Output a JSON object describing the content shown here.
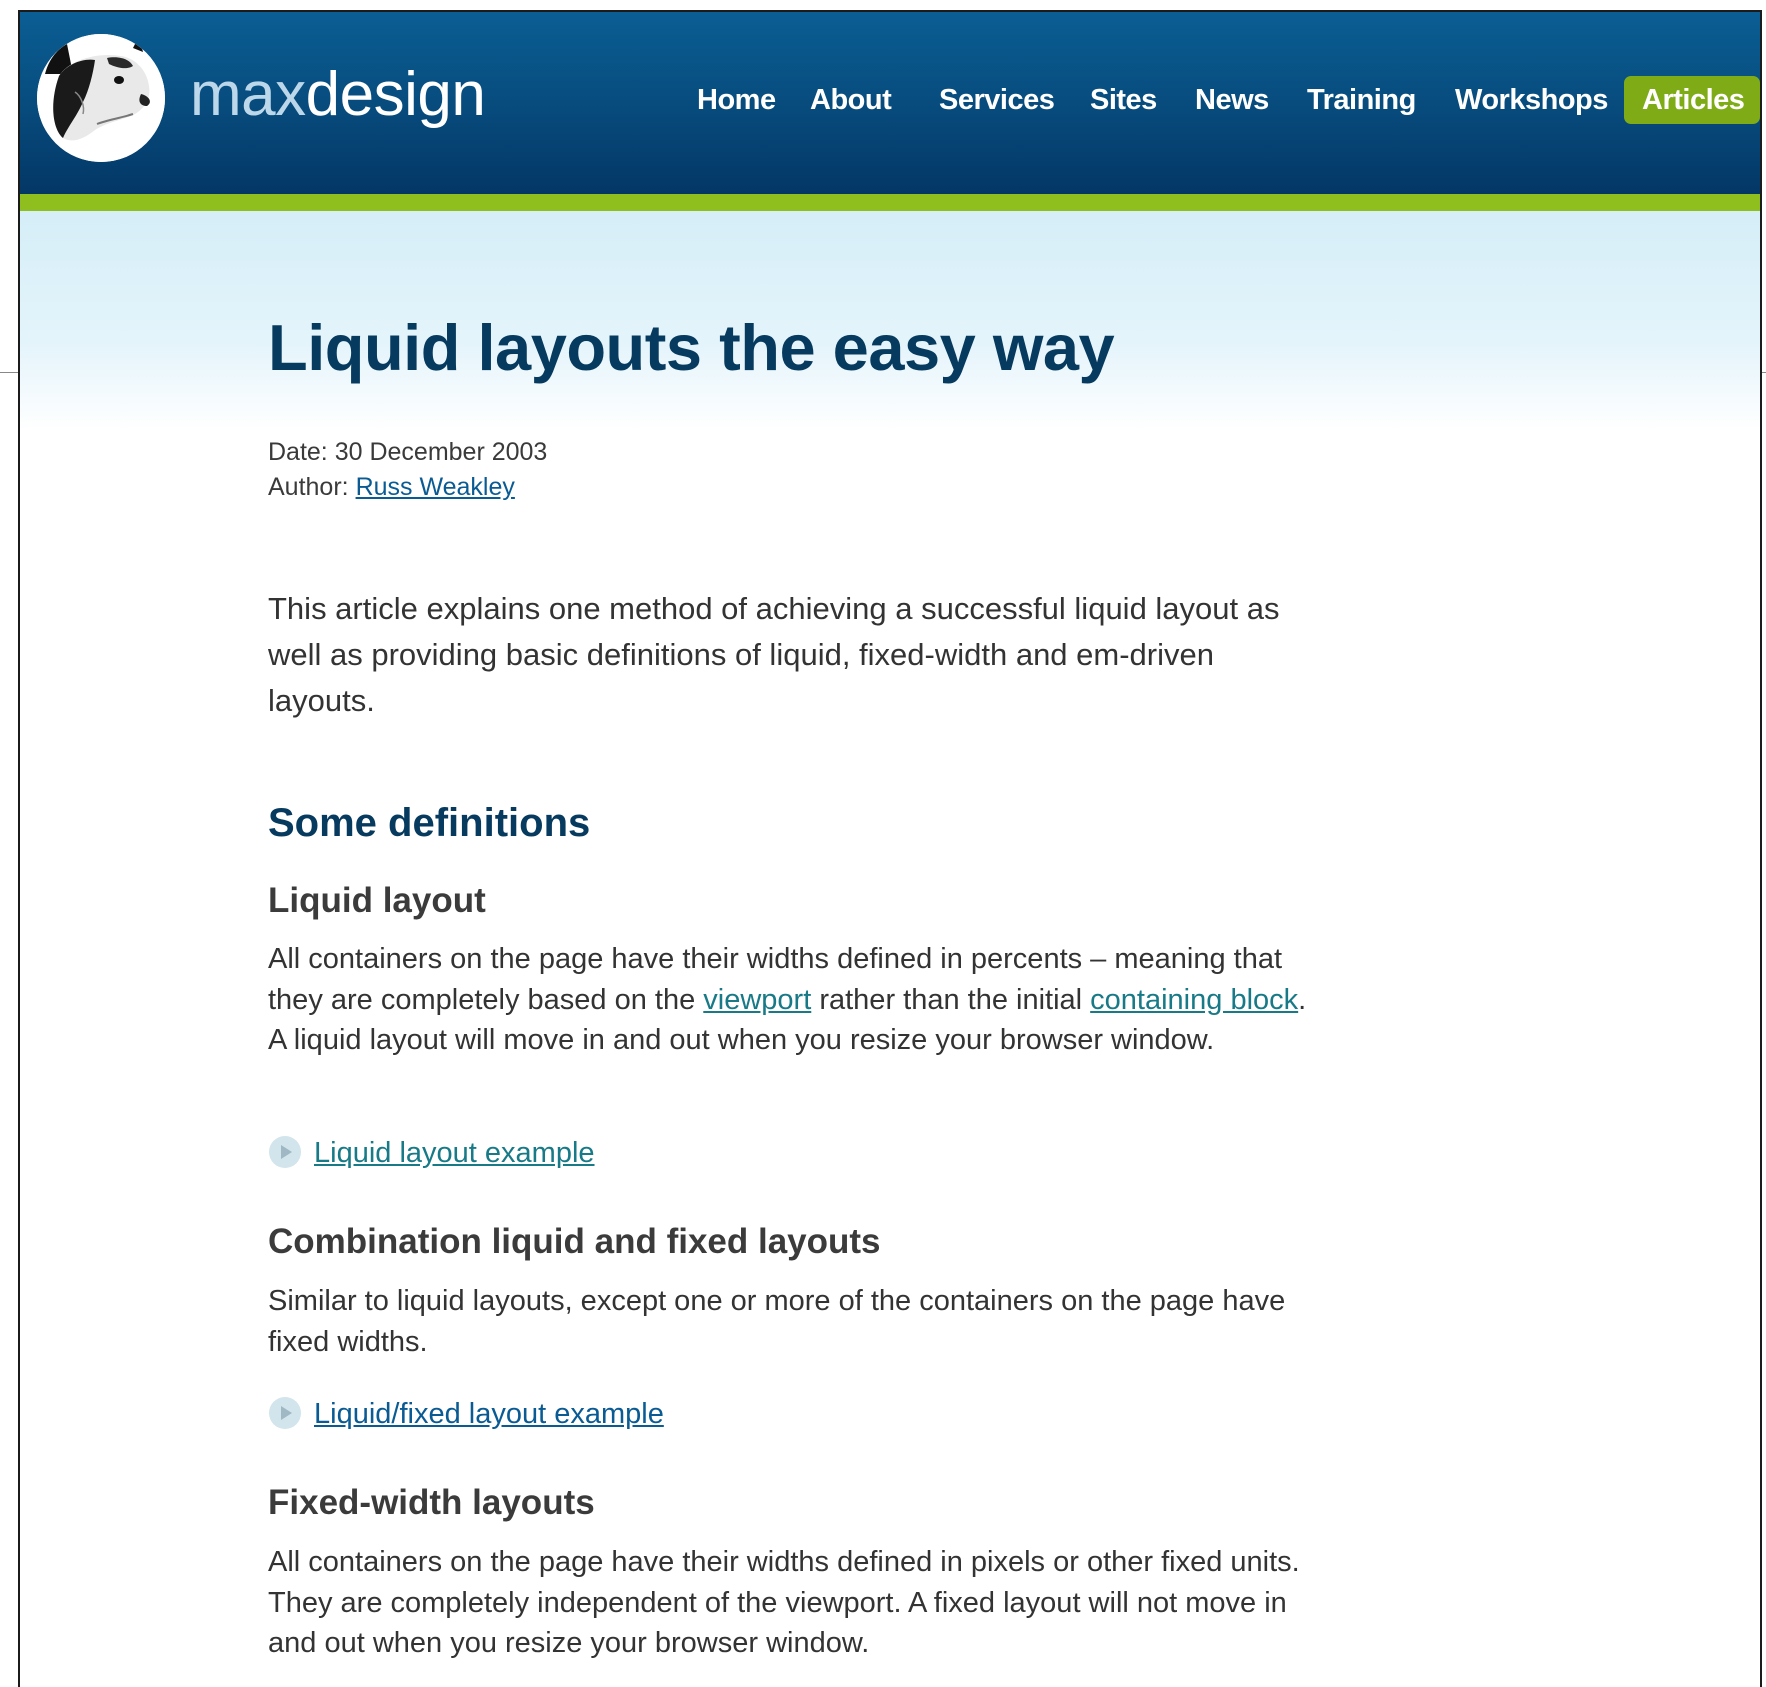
{
  "site": {
    "logo_part1": "max",
    "logo_part2": "design",
    "brand_colors": {
      "header_top": "#0a5e94",
      "header_bottom": "#033766",
      "accent_green": "#8fbe1f",
      "title_color": "#063a5e",
      "link_color": "#0a5b93"
    }
  },
  "nav": {
    "items": [
      {
        "label": "Home"
      },
      {
        "label": "About"
      },
      {
        "label": "Services"
      },
      {
        "label": "Sites"
      },
      {
        "label": "News"
      },
      {
        "label": "Training"
      },
      {
        "label": "Workshops"
      },
      {
        "label": "Articles",
        "active": true
      }
    ]
  },
  "article": {
    "title": "Liquid layouts the easy way",
    "date_label": "Date: ",
    "date_value": "30 December 2003",
    "author_label": "Author: ",
    "author_name": "Russ Weakley",
    "intro": "This article explains one method of achieving a successful liquid layout as well as providing basic definitions of liquid, fixed-width and em-driven layouts.",
    "section_heading": "Some definitions",
    "liquid": {
      "heading": "Liquid layout",
      "text_1": "All containers on the page have their widths defined in percents – meaning that they are completely based on the ",
      "link_viewport": "viewport",
      "text_2": " rather than the initial ",
      "link_containing_block": "containing block",
      "text_3": ". A liquid layout will move in and out when you resize your browser window.",
      "example_link": "Liquid layout example"
    },
    "combination": {
      "heading": "Combination liquid and fixed layouts",
      "text": "Similar to liquid layouts, except one or more of the containers on the page have fixed widths.",
      "example_link": "Liquid/fixed layout example"
    },
    "fixed": {
      "heading": "Fixed-width layouts",
      "text": "All containers on the page have their widths defined in pixels or other fixed units. They are completely independent of the viewport. A fixed layout will not move in and out when you resize your browser window."
    },
    "icons": {
      "example_icon": "play-circle-icon",
      "logo_icon": "dog-logo-icon"
    }
  }
}
